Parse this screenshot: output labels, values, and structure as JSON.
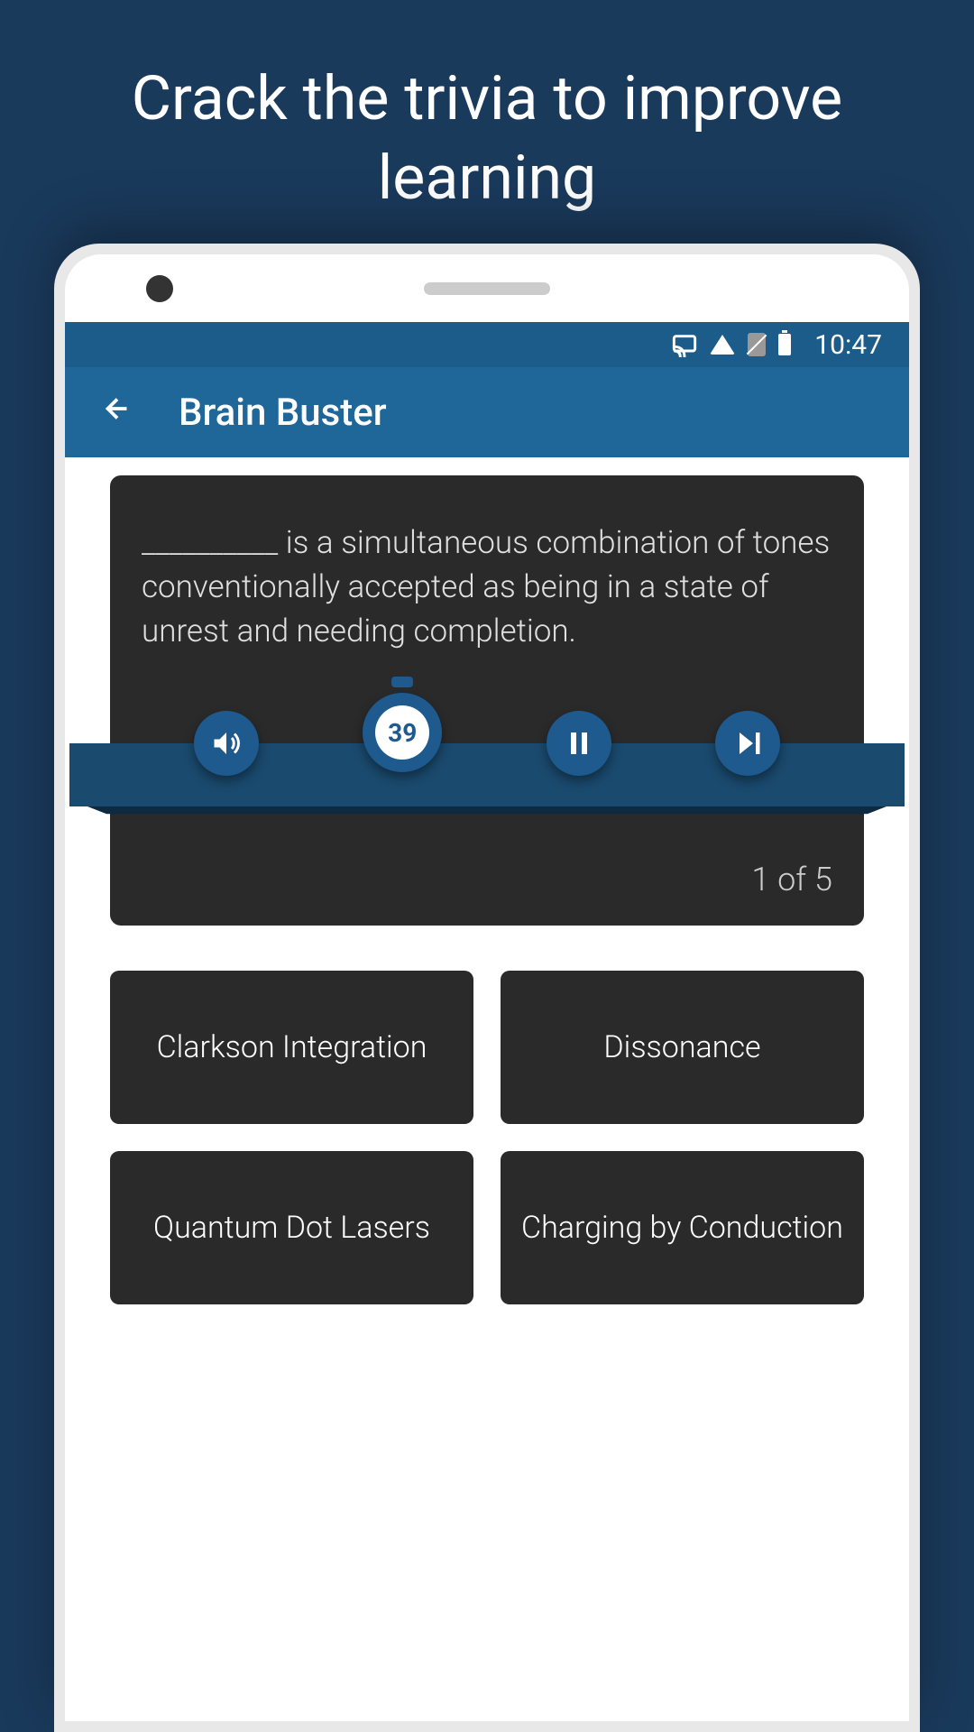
{
  "promo": {
    "headline": "Crack the trivia to improve learning"
  },
  "status_bar": {
    "time": "10:47"
  },
  "app_bar": {
    "title": "Brain Buster"
  },
  "question": {
    "text": "__________ is a simultaneous combination of tones conventionally accepted as being in a state of unrest and needing completion.",
    "progress": "1 of 5"
  },
  "timer": {
    "value": "39"
  },
  "answers": [
    "Clarkson Integration",
    "Dissonance",
    "Quantum Dot Lasers",
    "Charging by Conduction"
  ]
}
